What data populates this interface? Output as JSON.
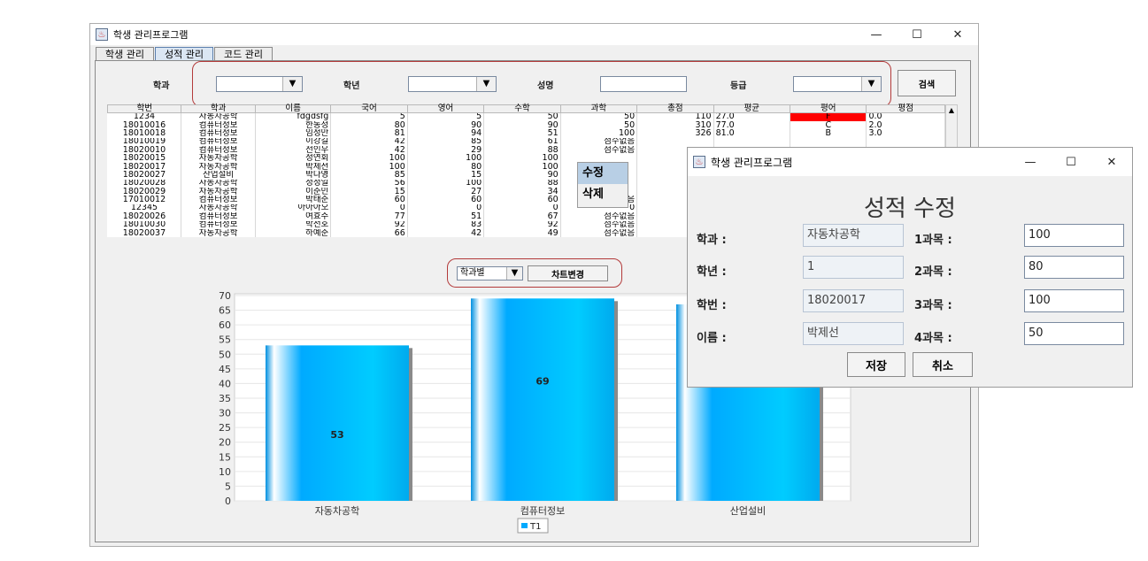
{
  "window": {
    "title": "학생 관리프로그램",
    "minimize": "—",
    "maximize": "☐",
    "close": "✕"
  },
  "tabs": [
    "학생 관리",
    "성적 관리",
    "코드 관리"
  ],
  "filters": {
    "dept_label": "학과",
    "grade_label": "학년",
    "name_label": "성명",
    "level_label": "등급",
    "search_button": "검색"
  },
  "table": {
    "headers": [
      "학번",
      "학과",
      "이름",
      "국어",
      "영어",
      "수학",
      "과학",
      "총점",
      "평균",
      "평어",
      "평점"
    ],
    "rows": [
      [
        "1234",
        "자동차공학",
        "fdgdsfg",
        "5",
        "5",
        "50",
        "50",
        "110",
        "27.0",
        "F",
        "0.0"
      ],
      [
        "18010016",
        "컴퓨터정보",
        "한동성",
        "80",
        "90",
        "90",
        "50",
        "310",
        "77.0",
        "C",
        "2.0"
      ],
      [
        "18010018",
        "컴퓨터정보",
        "임정만",
        "81",
        "94",
        "51",
        "100",
        "326",
        "81.0",
        "B",
        "3.0"
      ],
      [
        "18010019",
        "컴퓨터정보",
        "이강길",
        "42",
        "85",
        "61",
        "점수없음",
        "",
        "",
        "",
        ""
      ],
      [
        "18020010",
        "컴퓨터정보",
        "전인우",
        "42",
        "29",
        "88",
        "점수없음",
        "",
        "",
        "",
        ""
      ],
      [
        "18020015",
        "자동차공학",
        "정연회",
        "100",
        "100",
        "100",
        "",
        "",
        "",
        "",
        ""
      ],
      [
        "18020017",
        "자동차공학",
        "박제선",
        "100",
        "80",
        "100",
        "",
        "",
        "",
        "",
        ""
      ],
      [
        "18020027",
        "산업설비",
        "박다영",
        "85",
        "15",
        "90",
        "",
        "",
        "",
        "",
        ""
      ],
      [
        "18020028",
        "자동차공학",
        "정정일",
        "56",
        "100",
        "88",
        "",
        "",
        "",
        "",
        ""
      ],
      [
        "18020029",
        "자동차공학",
        "이준민",
        "15",
        "27",
        "34",
        "",
        "",
        "",
        "",
        ""
      ],
      [
        "17010012",
        "컴퓨터정보",
        "박태준",
        "60",
        "60",
        "60",
        "점수없음",
        "",
        "",
        "",
        ""
      ],
      [
        "12345",
        "자동차공학",
        "아아아오",
        "0",
        "0",
        "0",
        "0",
        "",
        "",
        "",
        ""
      ],
      [
        "18020026",
        "컴퓨터정보",
        "여효주",
        "77",
        "51",
        "67",
        "점수없음",
        "",
        "",
        "",
        ""
      ],
      [
        "18010030",
        "컴퓨터정보",
        "박선호",
        "92",
        "83",
        "92",
        "점수없음",
        "",
        "",
        "",
        ""
      ],
      [
        "18020037",
        "자동차공학",
        "하예준",
        "66",
        "42",
        "49",
        "점수없음",
        "",
        "",
        "",
        ""
      ]
    ]
  },
  "context_menu": {
    "edit": "수정",
    "delete": "삭제"
  },
  "chart_controls": {
    "group_by": "학과별",
    "change_button": "차트변경"
  },
  "chart_data": {
    "type": "bar",
    "categories": [
      "자동차공학",
      "컴퓨터정보",
      "산업설비"
    ],
    "series": [
      {
        "name": "T1",
        "values": [
          53,
          69,
          67
        ]
      }
    ],
    "ylim": [
      0,
      70
    ],
    "yticks": [
      0,
      5,
      10,
      15,
      20,
      25,
      30,
      35,
      40,
      45,
      50,
      55,
      60,
      65,
      70
    ],
    "grid": true,
    "legend": "bottom-center",
    "bar_color": "#00aaff"
  },
  "dialog": {
    "title": "학생 관리프로그램",
    "heading": "성적 수정",
    "dept_label": "학과 :",
    "dept_value": "자동차공학",
    "year_label": "학년 :",
    "year_value": "1",
    "id_label": "학번 :",
    "id_value": "18020017",
    "name_label": "이름 :",
    "name_value": "박제선",
    "s1_label": "1과목 :",
    "s1_value": "100",
    "s2_label": "2과목 :",
    "s2_value": "80",
    "s3_label": "3과목 :",
    "s3_value": "100",
    "s4_label": "4과목 :",
    "s4_value": "50",
    "save_button": "저장",
    "cancel_button": "취소"
  },
  "colors": {
    "accent_red": "#b33a3a",
    "grade_f": "#ff0000",
    "bar": "#00aaff"
  }
}
